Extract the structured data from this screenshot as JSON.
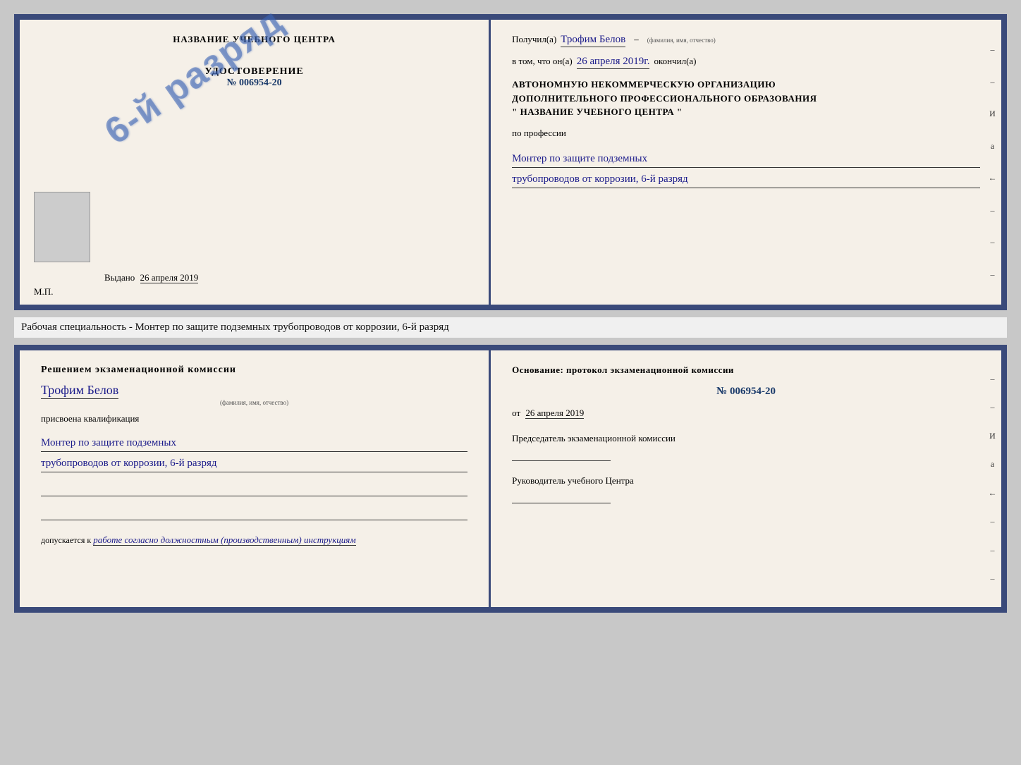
{
  "page": {
    "background": "#c8c8c8"
  },
  "top_cert": {
    "left": {
      "school_name": "НАЗВАНИЕ УЧЕБНОГО ЦЕНТРА",
      "udostoverenie_title": "УДОСТОВЕРЕНИЕ",
      "udostoverenie_num": "№ 006954-20",
      "stamp_text": "6-й разряд",
      "vydano_label": "Выдано",
      "vydano_date": "26 апреля 2019",
      "mp_label": "М.П."
    },
    "right": {
      "poluchil_label": "Получил(а)",
      "person_name": "Трофим Белов",
      "fio_label": "(фамилия, имя, отчество)",
      "vtom_label": "в том, что он(а)",
      "date_value": "26 апреля 2019г.",
      "okonchil_label": "окончил(а)",
      "org_line1": "АВТОНОМНУЮ НЕКОММЕРЧЕСКУЮ ОРГАНИЗАЦИЮ",
      "org_line2": "ДОПОЛНИТЕЛЬНОГО ПРОФЕССИОНАЛЬНОГО ОБРАЗОВАНИЯ",
      "org_line3": "\"   НАЗВАНИЕ УЧЕБНОГО ЦЕНТРА   \"",
      "po_professii": "по профессии",
      "profession_line1": "Монтер по защите подземных",
      "profession_line2": "трубопроводов от коррозии, 6-й разряд"
    }
  },
  "specialty_line": {
    "text": "Рабочая специальность - Монтер по защите подземных трубопроводов от коррозии, 6-й разряд"
  },
  "bottom_cert": {
    "left": {
      "resheniem_title": "Решением  экзаменационной  комиссии",
      "person_name": "Трофим Белов",
      "fio_label": "(фамилия, имя, отчество)",
      "prisvoena_label": "присвоена квалификация",
      "qualification_line1": "Монтер по защите подземных",
      "qualification_line2": "трубопроводов от коррозии, 6-й разряд",
      "dopuskaetsya_label": "допускается к",
      "dopuskaetsya_value": "работе согласно должностным (производственным) инструкциям"
    },
    "right": {
      "osnovanie_label": "Основание: протокол экзаменационной  комиссии",
      "protocol_num": "№  006954-20",
      "ot_label": "от",
      "ot_date": "26 апреля 2019",
      "predsedatel_title": "Председатель экзаменационной комиссии",
      "rukovoditel_title": "Руководитель учебного Центра"
    }
  },
  "side_marks": {
    "chars": [
      "И",
      "а",
      "←",
      "–",
      "–",
      "–",
      "–",
      "–"
    ]
  }
}
